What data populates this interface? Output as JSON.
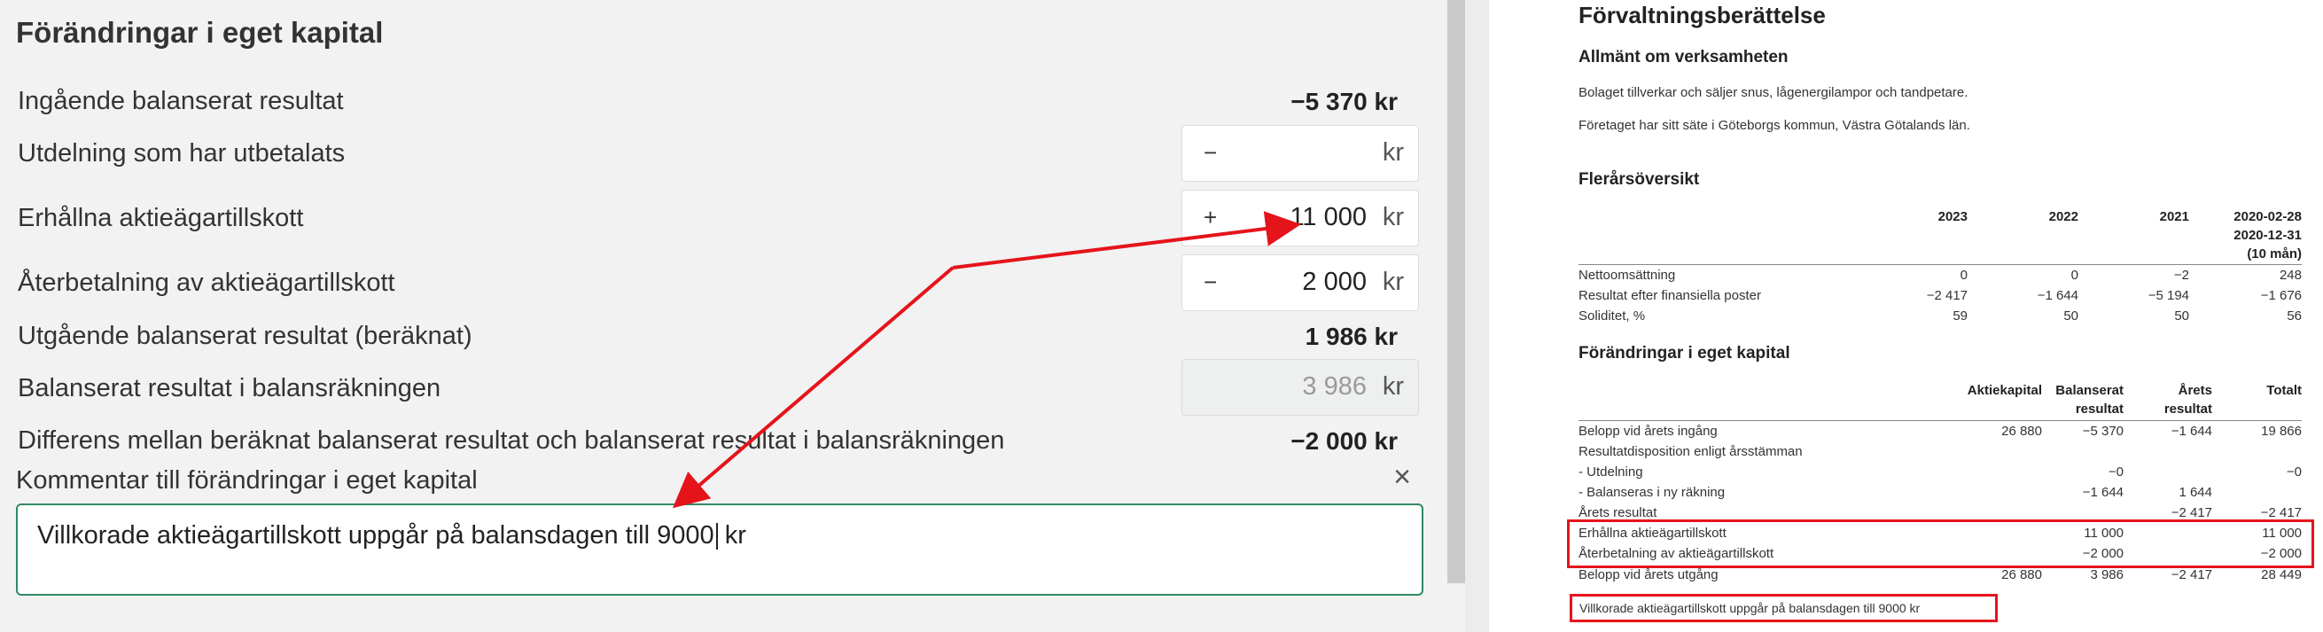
{
  "form": {
    "title": "Förändringar i eget kapital",
    "rows": {
      "ingaende": {
        "label": "Ingående balanserat resultat",
        "value": "−5 370 kr"
      },
      "utdelning": {
        "label": "Utdelning som har utbetalats",
        "sign": "−",
        "value": "",
        "unit": "kr"
      },
      "erhallna": {
        "label": "Erhållna aktieägartillskott",
        "sign": "+",
        "value": "11 000",
        "unit": "kr"
      },
      "aterbetalning": {
        "label": "Återbetalning av aktieägartillskott",
        "sign": "−",
        "value": "2 000",
        "unit": "kr"
      },
      "utgaende": {
        "label": "Utgående balanserat resultat (beräknat)",
        "value": "1 986 kr"
      },
      "balansrakning": {
        "label": "Balanserat resultat i balansräkningen",
        "value": "3 986",
        "unit": "kr"
      },
      "differens": {
        "label": "Differens mellan beräknat balanserat resultat och balanserat resultat i balansräkningen",
        "value": "−2 000 kr"
      }
    },
    "comment_label": "Kommentar till förändringar i eget kapital",
    "close_icon": "×",
    "comment_text": "Villkorade aktieägartillskott uppgår på balansdagen till 9000",
    "comment_suffix": " kr"
  },
  "document": {
    "title": "Förvaltningsberättelse",
    "section1": {
      "heading": "Allmänt om verksamheten",
      "p1": "Bolaget tillverkar och säljer snus, lågenergilampor och tandpetare.",
      "p2": "Företaget har sitt säte i Göteborgs kommun, Västra Götalands län."
    },
    "section2": {
      "heading": "Flerårsöversikt",
      "columns": [
        "2023",
        "2022",
        "2021",
        "2020-02-28",
        "2020-12-31",
        "(10 mån)"
      ],
      "rows": [
        {
          "label": "Nettoomsättning",
          "values": [
            "0",
            "0",
            "−2",
            "248"
          ]
        },
        {
          "label": "Resultat efter finansiella poster",
          "values": [
            "−2 417",
            "−1 644",
            "−5 194",
            "−1 676"
          ]
        },
        {
          "label": "Soliditet, %",
          "values": [
            "59",
            "50",
            "50",
            "56"
          ]
        }
      ]
    },
    "section3": {
      "heading": "Förändringar i eget kapital",
      "columns": {
        "aktiekapital": "Aktiekapital",
        "balanserat1": "Balanserat",
        "balanserat2": "resultat",
        "arets1": "Årets",
        "arets2": "resultat",
        "totalt": "Totalt"
      },
      "rows": [
        {
          "label": "Belopp vid årets ingång",
          "values": [
            "26 880",
            "−5 370",
            "−1 644",
            "19 866"
          ]
        },
        {
          "label": "Resultatdisposition enligt årsstämman",
          "values": [
            "",
            "",
            "",
            ""
          ]
        },
        {
          "label": "- Utdelning",
          "values": [
            "",
            "−0",
            "",
            "−0"
          ]
        },
        {
          "label": "- Balanseras i ny räkning",
          "values": [
            "",
            "−1 644",
            "1 644",
            ""
          ]
        },
        {
          "label": "Årets resultat",
          "values": [
            "",
            "",
            "−2 417",
            "−2 417"
          ]
        },
        {
          "label": "Erhållna aktieägartillskott",
          "values": [
            "",
            "11 000",
            "",
            "11 000"
          ]
        },
        {
          "label": "Återbetalning av aktieägartillskott",
          "values": [
            "",
            "−2 000",
            "",
            "−2 000"
          ]
        },
        {
          "label": "Belopp vid årets utgång",
          "values": [
            "26 880",
            "3 986",
            "−2 417",
            "28 449"
          ]
        }
      ],
      "note": "Villkorade aktieägartillskott uppgår på balansdagen till 9000 kr"
    }
  },
  "colors": {
    "annotation": "#e5141b",
    "focus_border": "#2f8a63"
  }
}
